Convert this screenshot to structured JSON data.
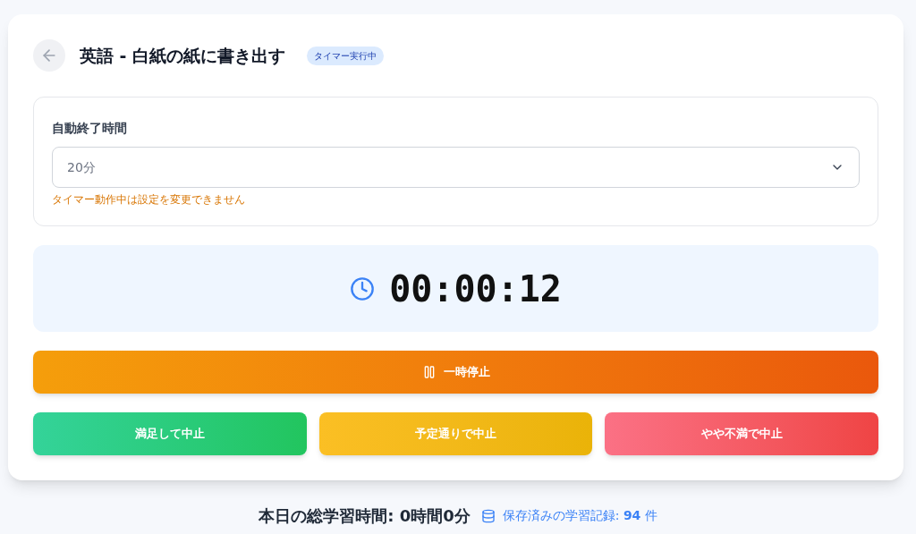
{
  "header": {
    "title": "英語 - 白紙の紙に書き出す",
    "badge": "タイマー実行中"
  },
  "settings": {
    "label": "自動終了時間",
    "select": {
      "value": "20分",
      "disabled": true
    },
    "warning": "タイマー動作中は設定を変更できません"
  },
  "timer": {
    "time": "00:00:12"
  },
  "buttons": [
    {
      "kind": "pause",
      "label": "一時停止"
    }
  ],
  "stop_buttons": [
    {
      "kind": "satisfied",
      "label": "満足して中止"
    },
    {
      "kind": "planned",
      "label": "予定通りで中止"
    },
    {
      "kind": "unsatisfied",
      "label": "やや不満で中止"
    }
  ],
  "footer": {
    "total": "本日の総学習時間: 0時間0分",
    "records": "保存済みの学習記録: **94** 件"
  }
}
